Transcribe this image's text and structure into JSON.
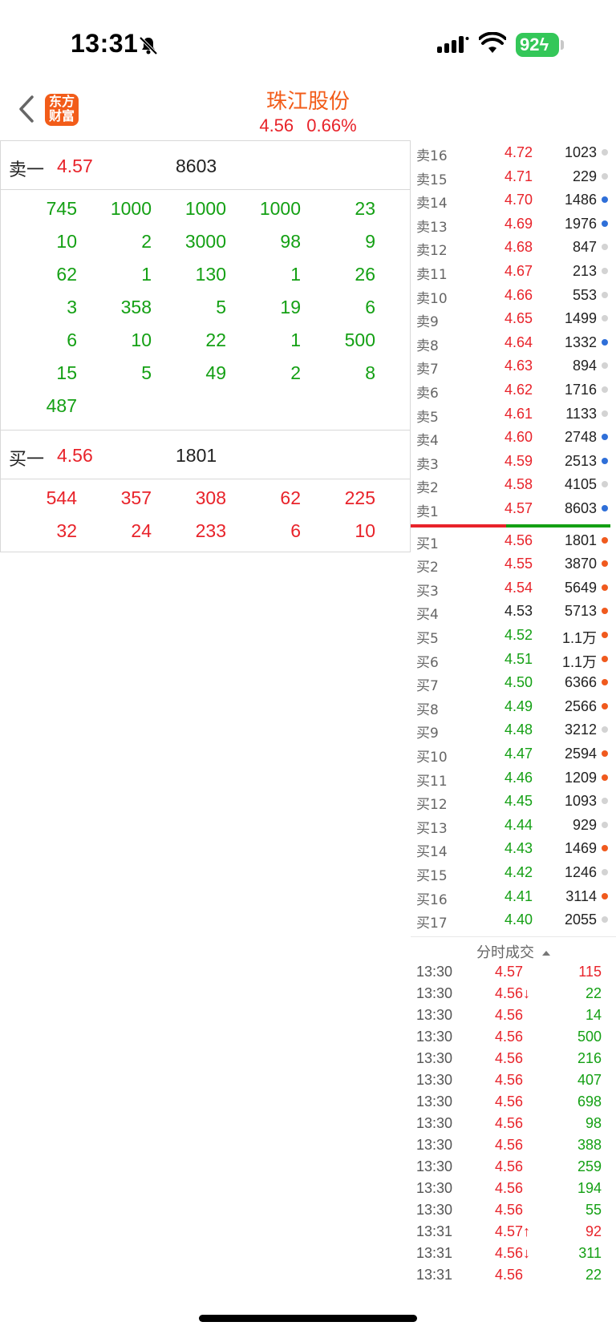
{
  "status_bar": {
    "time": "13:31",
    "battery": "92"
  },
  "header": {
    "logo": [
      "东方",
      "财富"
    ],
    "title": "珠江股份",
    "price": "4.56",
    "change_pct": "0.66%"
  },
  "book": {
    "ask": {
      "label": "卖一",
      "price": "4.57",
      "volume": "8603",
      "orders": [
        "745",
        "1000",
        "1000",
        "1000",
        "23",
        "10",
        "2",
        "3000",
        "98",
        "9",
        "62",
        "1",
        "130",
        "1",
        "26",
        "3",
        "358",
        "5",
        "19",
        "6",
        "6",
        "10",
        "22",
        "1",
        "500",
        "15",
        "5",
        "49",
        "2",
        "8",
        "487"
      ]
    },
    "bid": {
      "label": "买一",
      "price": "4.56",
      "volume": "1801",
      "orders": [
        "544",
        "357",
        "308",
        "62",
        "225",
        "32",
        "24",
        "233",
        "6",
        "10"
      ]
    }
  },
  "depth": {
    "asks": [
      {
        "label": "卖16",
        "price": "4.72",
        "vol": "1023",
        "dot": "grey"
      },
      {
        "label": "卖15",
        "price": "4.71",
        "vol": "229",
        "dot": "grey"
      },
      {
        "label": "卖14",
        "price": "4.70",
        "vol": "1486",
        "dot": "blue"
      },
      {
        "label": "卖13",
        "price": "4.69",
        "vol": "1976",
        "dot": "blue"
      },
      {
        "label": "卖12",
        "price": "4.68",
        "vol": "847",
        "dot": "grey"
      },
      {
        "label": "卖11",
        "price": "4.67",
        "vol": "213",
        "dot": "grey"
      },
      {
        "label": "卖10",
        "price": "4.66",
        "vol": "553",
        "dot": "grey"
      },
      {
        "label": "卖9",
        "price": "4.65",
        "vol": "1499",
        "dot": "grey"
      },
      {
        "label": "卖8",
        "price": "4.64",
        "vol": "1332",
        "dot": "blue"
      },
      {
        "label": "卖7",
        "price": "4.63",
        "vol": "894",
        "dot": "grey"
      },
      {
        "label": "卖6",
        "price": "4.62",
        "vol": "1716",
        "dot": "grey"
      },
      {
        "label": "卖5",
        "price": "4.61",
        "vol": "1133",
        "dot": "grey"
      },
      {
        "label": "卖4",
        "price": "4.60",
        "vol": "2748",
        "dot": "blue"
      },
      {
        "label": "卖3",
        "price": "4.59",
        "vol": "2513",
        "dot": "blue"
      },
      {
        "label": "卖2",
        "price": "4.58",
        "vol": "4105",
        "dot": "grey"
      },
      {
        "label": "卖1",
        "price": "4.57",
        "vol": "8603",
        "dot": "blue"
      }
    ],
    "bids": [
      {
        "label": "买1",
        "price": "4.56",
        "vol": "1801",
        "dot": "orange",
        "color": "red"
      },
      {
        "label": "买2",
        "price": "4.55",
        "vol": "3870",
        "dot": "orange",
        "color": "red"
      },
      {
        "label": "买3",
        "price": "4.54",
        "vol": "5649",
        "dot": "orange",
        "color": "red"
      },
      {
        "label": "买4",
        "price": "4.53",
        "vol": "5713",
        "dot": "orange",
        "color": "black"
      },
      {
        "label": "买5",
        "price": "4.52",
        "vol": "1.1万",
        "dot": "orange",
        "color": "green"
      },
      {
        "label": "买6",
        "price": "4.51",
        "vol": "1.1万",
        "dot": "orange",
        "color": "green"
      },
      {
        "label": "买7",
        "price": "4.50",
        "vol": "6366",
        "dot": "orange",
        "color": "green"
      },
      {
        "label": "买8",
        "price": "4.49",
        "vol": "2566",
        "dot": "orange",
        "color": "green"
      },
      {
        "label": "买9",
        "price": "4.48",
        "vol": "3212",
        "dot": "grey",
        "color": "green"
      },
      {
        "label": "买10",
        "price": "4.47",
        "vol": "2594",
        "dot": "orange",
        "color": "green"
      },
      {
        "label": "买11",
        "price": "4.46",
        "vol": "1209",
        "dot": "orange",
        "color": "green"
      },
      {
        "label": "买12",
        "price": "4.45",
        "vol": "1093",
        "dot": "grey",
        "color": "green"
      },
      {
        "label": "买13",
        "price": "4.44",
        "vol": "929",
        "dot": "grey",
        "color": "green"
      },
      {
        "label": "买14",
        "price": "4.43",
        "vol": "1469",
        "dot": "orange",
        "color": "green"
      },
      {
        "label": "买15",
        "price": "4.42",
        "vol": "1246",
        "dot": "grey",
        "color": "green"
      },
      {
        "label": "买16",
        "price": "4.41",
        "vol": "3114",
        "dot": "orange",
        "color": "green"
      },
      {
        "label": "买17",
        "price": "4.40",
        "vol": "2055",
        "dot": "grey",
        "color": "green"
      }
    ]
  },
  "trades": {
    "title": "分时成交",
    "rows": [
      {
        "time": "13:30",
        "price": "4.57",
        "vol": "115",
        "vcolor": "red"
      },
      {
        "time": "13:30",
        "price": "4.56↓",
        "vol": "22",
        "vcolor": "green"
      },
      {
        "time": "13:30",
        "price": "4.56",
        "vol": "14",
        "vcolor": "green"
      },
      {
        "time": "13:30",
        "price": "4.56",
        "vol": "500",
        "vcolor": "green"
      },
      {
        "time": "13:30",
        "price": "4.56",
        "vol": "216",
        "vcolor": "green"
      },
      {
        "time": "13:30",
        "price": "4.56",
        "vol": "407",
        "vcolor": "green"
      },
      {
        "time": "13:30",
        "price": "4.56",
        "vol": "698",
        "vcolor": "green"
      },
      {
        "time": "13:30",
        "price": "4.56",
        "vol": "98",
        "vcolor": "green"
      },
      {
        "time": "13:30",
        "price": "4.56",
        "vol": "388",
        "vcolor": "green"
      },
      {
        "time": "13:30",
        "price": "4.56",
        "vol": "259",
        "vcolor": "green"
      },
      {
        "time": "13:30",
        "price": "4.56",
        "vol": "194",
        "vcolor": "green"
      },
      {
        "time": "13:30",
        "price": "4.56",
        "vol": "55",
        "vcolor": "green"
      },
      {
        "time": "13:31",
        "price": "4.57↑",
        "vol": "92",
        "vcolor": "red"
      },
      {
        "time": "13:31",
        "price": "4.56↓",
        "vol": "311",
        "vcolor": "green"
      },
      {
        "time": "13:31",
        "price": "4.56",
        "vol": "22",
        "vcolor": "green"
      }
    ]
  },
  "colors": {
    "up": "#e8232a",
    "down": "#14a014",
    "brand": "#f25c19"
  }
}
